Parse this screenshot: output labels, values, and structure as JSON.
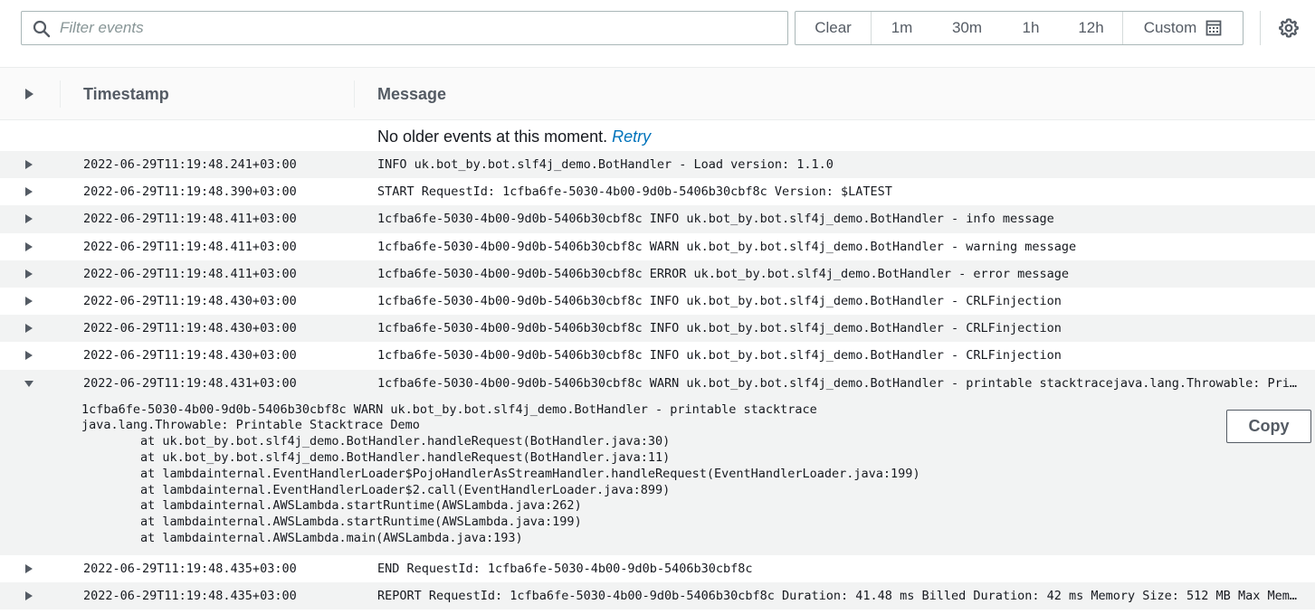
{
  "filter": {
    "placeholder": "Filter events",
    "value": ""
  },
  "time_range": {
    "clear": "Clear",
    "options": [
      "1m",
      "30m",
      "1h",
      "12h"
    ],
    "custom": "Custom"
  },
  "table": {
    "columns": {
      "timestamp": "Timestamp",
      "message": "Message"
    },
    "notice": {
      "text": "No older events at this moment. ",
      "retry": "Retry"
    },
    "rows": [
      {
        "timestamp": "2022-06-29T11:19:48.241+03:00",
        "message": "INFO uk.bot_by.bot.slf4j_demo.BotHandler - Load version: 1.1.0"
      },
      {
        "timestamp": "2022-06-29T11:19:48.390+03:00",
        "message": "START RequestId: 1cfba6fe-5030-4b00-9d0b-5406b30cbf8c Version: $LATEST"
      },
      {
        "timestamp": "2022-06-29T11:19:48.411+03:00",
        "message": "1cfba6fe-5030-4b00-9d0b-5406b30cbf8c INFO uk.bot_by.bot.slf4j_demo.BotHandler - info message"
      },
      {
        "timestamp": "2022-06-29T11:19:48.411+03:00",
        "message": "1cfba6fe-5030-4b00-9d0b-5406b30cbf8c WARN uk.bot_by.bot.slf4j_demo.BotHandler - warning message"
      },
      {
        "timestamp": "2022-06-29T11:19:48.411+03:00",
        "message": "1cfba6fe-5030-4b00-9d0b-5406b30cbf8c ERROR uk.bot_by.bot.slf4j_demo.BotHandler - error message"
      },
      {
        "timestamp": "2022-06-29T11:19:48.430+03:00",
        "message": "1cfba6fe-5030-4b00-9d0b-5406b30cbf8c INFO uk.bot_by.bot.slf4j_demo.BotHandler - CRLFinjection"
      },
      {
        "timestamp": "2022-06-29T11:19:48.430+03:00",
        "message": "1cfba6fe-5030-4b00-9d0b-5406b30cbf8c INFO uk.bot_by.bot.slf4j_demo.BotHandler - CRLFinjection"
      },
      {
        "timestamp": "2022-06-29T11:19:48.430+03:00",
        "message": "1cfba6fe-5030-4b00-9d0b-5406b30cbf8c INFO uk.bot_by.bot.slf4j_demo.BotHandler - CRLFinjection"
      },
      {
        "timestamp": "2022-06-29T11:19:48.431+03:00",
        "message": "1cfba6fe-5030-4b00-9d0b-5406b30cbf8c WARN uk.bot_by.bot.slf4j_demo.BotHandler - printable stacktracejava.lang.Throwable: Print…",
        "expanded": true
      },
      {
        "timestamp": "2022-06-29T11:19:48.435+03:00",
        "message": "END RequestId: 1cfba6fe-5030-4b00-9d0b-5406b30cbf8c"
      },
      {
        "timestamp": "2022-06-29T11:19:48.435+03:00",
        "message": "REPORT RequestId: 1cfba6fe-5030-4b00-9d0b-5406b30cbf8c Duration: 41.48 ms Billed Duration: 42 ms Memory Size: 512 MB Max Memor…"
      }
    ],
    "expanded_detail": {
      "text": "1cfba6fe-5030-4b00-9d0b-5406b30cbf8c WARN uk.bot_by.bot.slf4j_demo.BotHandler - printable stacktrace\njava.lang.Throwable: Printable Stacktrace Demo\n\tat uk.bot_by.bot.slf4j_demo.BotHandler.handleRequest(BotHandler.java:30)\n\tat uk.bot_by.bot.slf4j_demo.BotHandler.handleRequest(BotHandler.java:11)\n\tat lambdainternal.EventHandlerLoader$PojoHandlerAsStreamHandler.handleRequest(EventHandlerLoader.java:199)\n\tat lambdainternal.EventHandlerLoader$2.call(EventHandlerLoader.java:899)\n\tat lambdainternal.AWSLambda.startRuntime(AWSLambda.java:262)\n\tat lambdainternal.AWSLambda.startRuntime(AWSLambda.java:199)\n\tat lambdainternal.AWSLambda.main(AWSLambda.java:193)",
      "copy_label": "Copy"
    }
  },
  "icons": {
    "search": "search-icon",
    "calendar": "calendar-icon",
    "settings": "gear-icon",
    "expand": "caret-right-icon",
    "collapse": "caret-down-icon"
  },
  "colors": {
    "link": "#0073bb",
    "row_alt": "#f2f3f3",
    "text": "#16191f",
    "muted": "#545b64"
  }
}
